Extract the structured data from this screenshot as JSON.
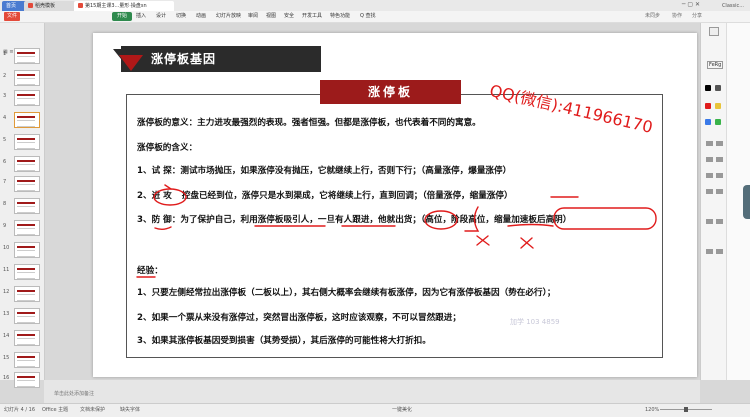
{
  "tabs": [
    {
      "label": "首页"
    },
    {
      "label": "稻壳模板"
    },
    {
      "label": "第15期主课3...量形·操盘sn"
    }
  ],
  "user": "Classic...",
  "menu": [
    "文件",
    "开始",
    "插入",
    "设计",
    "切换",
    "动画",
    "幻灯片放映",
    "审阅",
    "视图",
    "安全",
    "开发工具",
    "特色功能",
    "Q 查找"
  ],
  "menu_right": [
    "未同步",
    "协作",
    "分享"
  ],
  "slide": {
    "header_title": "涨停板基因",
    "red_tag": "涨停板",
    "meaning": "涨停板的意义：主力进攻最强烈的表现。强者恒强。但都是涨停板，也代表着不同的寓意。",
    "contains_label": "涨停板的含义：",
    "item1": "1、试 探：测试市场抛压，如果涨停没有抛压，它就继续上行，否则下行；（高量涨停，爆量涨停）",
    "item2_num": "2、",
    "item2_key": "进 攻",
    "item2_body": "控盘已经到位，涨停只是水到渠成，它将继续上行，直到回调；（倍量涨停，缩量涨停）",
    "item3_num": "3、",
    "item3_key": "防 御",
    "item3_body": "：为了保护自己，利用涨停板吸引人，一旦有人跟进，他就出货；（高位，阶段高位，缩量加速板后高阴）",
    "experience_label": "经验：",
    "exp1": "1、只要左侧经常拉出涨停板（二板以上），其右侧大概率会继续有板涨停，因为它有涨停板基因（势在必行）；",
    "exp2": "2、如果一个票从来没有涨停过，突然冒出涨停板，这时应该观察，不可以冒然跟进；",
    "exp3": "3、如果其涨停板基因受到损害（其势受损），其后涨停的可能性将大打折扣。",
    "overlay_qq": "QQ(微信):411966170",
    "watermark": "加学 103 4859"
  },
  "thumbs": [
    "1",
    "2",
    "3",
    "4",
    "5",
    "6",
    "7",
    "8",
    "9",
    "10",
    "11",
    "12",
    "13",
    "14",
    "15",
    "16"
  ],
  "right_panel": {
    "fmt_label": "FeRg"
  },
  "notes": "单击此处添加备注",
  "status": {
    "slide_count": "幻灯片 4 / 16",
    "theme": "Office 主题",
    "doc_protect": "文档未保护",
    "missing_font": "缺失字体",
    "smart": "一键美化",
    "zoom": "120%"
  },
  "colors": {
    "accent": "#9c1b1b",
    "ink": "#e01c1c",
    "start": "#2f8a4e"
  }
}
